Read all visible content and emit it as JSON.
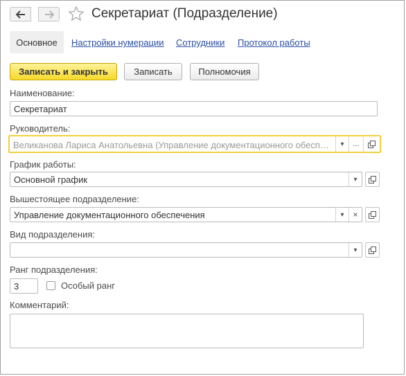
{
  "header": {
    "title": "Секретариат (Подразделение)",
    "back_icon": "arrow-left-icon",
    "forward_icon": "arrow-right-icon",
    "favorite_icon": "star-icon"
  },
  "tabs": [
    {
      "label": "Основное",
      "active": true
    },
    {
      "label": "Настройки нумерации",
      "active": false
    },
    {
      "label": "Сотрудники",
      "active": false
    },
    {
      "label": "Протокол работы",
      "active": false
    }
  ],
  "toolbar": {
    "save_close_label": "Записать и закрыть",
    "save_label": "Записать",
    "permissions_label": "Полномочия"
  },
  "form": {
    "name": {
      "label": "Наименование:",
      "value": "Секретариат"
    },
    "head": {
      "label": "Руководитель:",
      "value": "Великанова Лариса Анатольевна (Управление документационного обеспечения)"
    },
    "schedule": {
      "label": "График работы:",
      "value": "Основной график"
    },
    "parent": {
      "label": "Вышестоящее подразделение:",
      "value": "Управление документационного обеспечения"
    },
    "kind": {
      "label": "Вид подразделения:",
      "value": ""
    },
    "rank": {
      "label": "Ранг подразделения:",
      "value": "3",
      "special_label": "Особый ранг",
      "special_checked": false
    },
    "comment": {
      "label": "Комментарий:",
      "value": ""
    }
  },
  "glyphs": {
    "dropdown": "▾",
    "select": "...",
    "clear": "×"
  },
  "colors": {
    "primary_button": "#f6d92a",
    "link": "#2a4fa3",
    "focus_border": "#f2cf3c"
  }
}
